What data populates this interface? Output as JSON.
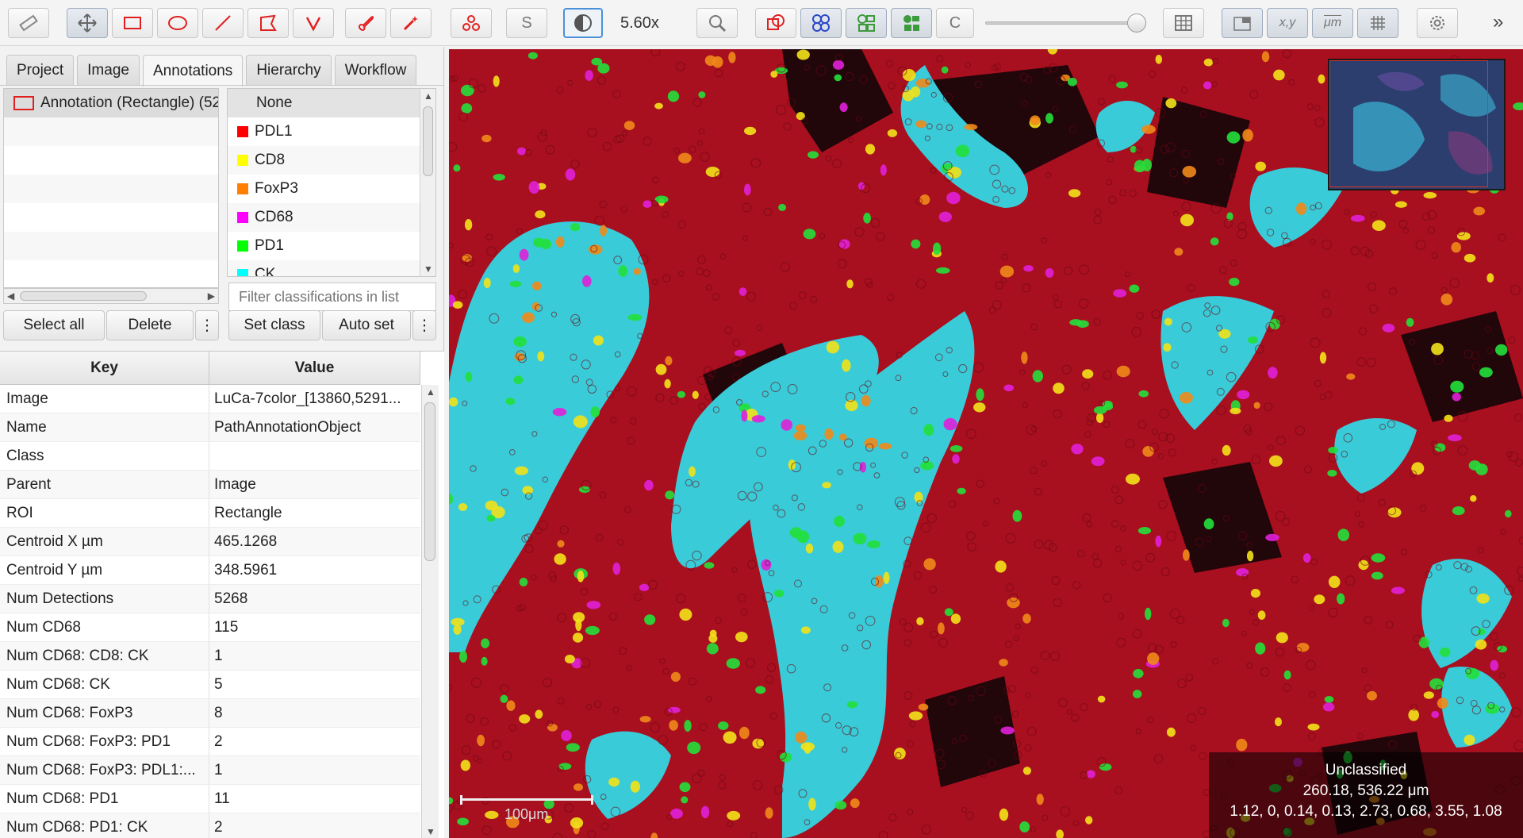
{
  "toolbar": {
    "zoom_label": "5.60x",
    "selection_mode_letter": "S",
    "c_button": "C",
    "xy_label": "x,y",
    "um_label": "μm"
  },
  "tabs": [
    {
      "label": "Project"
    },
    {
      "label": "Image"
    },
    {
      "label": "Annotations",
      "active": true
    },
    {
      "label": "Hierarchy"
    },
    {
      "label": "Workflow"
    }
  ],
  "annotations": {
    "items": [
      "Annotation (Rectangle) (52"
    ],
    "select_all": "Select all",
    "delete": "Delete",
    "more": "⋮"
  },
  "classes": {
    "items": [
      {
        "name": "None",
        "color": ""
      },
      {
        "name": "PDL1",
        "color": "#ff0000"
      },
      {
        "name": "CD8",
        "color": "#ffff00"
      },
      {
        "name": "FoxP3",
        "color": "#ff8000"
      },
      {
        "name": "CD68",
        "color": "#ff00ff"
      },
      {
        "name": "PD1",
        "color": "#00ff00"
      },
      {
        "name": "CK",
        "color": "#00ffff"
      }
    ],
    "filter_placeholder": "Filter classifications in list",
    "set_class": "Set class",
    "auto_set": "Auto set",
    "more": "⋮"
  },
  "properties": {
    "key_header": "Key",
    "value_header": "Value",
    "rows": [
      {
        "key": "Image",
        "value": "LuCa-7color_[13860,5291..."
      },
      {
        "key": "Name",
        "value": "PathAnnotationObject"
      },
      {
        "key": "Class",
        "value": ""
      },
      {
        "key": "Parent",
        "value": "Image"
      },
      {
        "key": "ROI",
        "value": "Rectangle"
      },
      {
        "key": "Centroid X µm",
        "value": "465.1268"
      },
      {
        "key": "Centroid Y µm",
        "value": "348.5961"
      },
      {
        "key": "Num Detections",
        "value": "5268"
      },
      {
        "key": "Num CD68",
        "value": "115"
      },
      {
        "key": "Num CD68: CD8: CK",
        "value": "1"
      },
      {
        "key": "Num CD68: CK",
        "value": "5"
      },
      {
        "key": "Num CD68: FoxP3",
        "value": "8"
      },
      {
        "key": "Num CD68: FoxP3: PD1",
        "value": "2"
      },
      {
        "key": "Num CD68: FoxP3: PDL1:...",
        "value": "1"
      },
      {
        "key": "Num CD68: PD1",
        "value": "11"
      },
      {
        "key": "Num CD68: PD1: CK",
        "value": "2"
      }
    ]
  },
  "viewer": {
    "scalebar_label": "100μm",
    "cursor_class": "Unclassified",
    "cursor_coords": "260.18, 536.22 μm",
    "cursor_values": "1.12, 0, 0.14, 0.13, 2.73, 0.68, 3.55, 1.08"
  },
  "colors": {
    "tissue_red": "#b0101f",
    "ck_cyan": "#3fd7e0",
    "pd1_green": "#22e03a",
    "cd8_yellow": "#f2e21a",
    "foxp3_orange": "#f08a1a",
    "cd68_magenta": "#e020d8"
  }
}
